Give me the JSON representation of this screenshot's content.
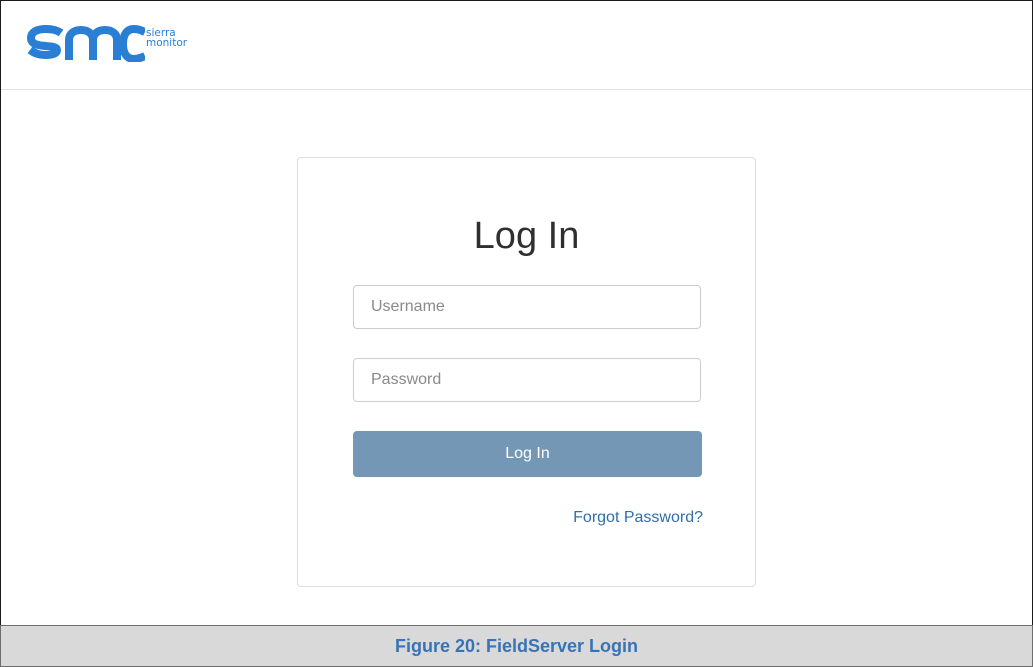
{
  "brand": {
    "logo_text": "smc",
    "sub_line1": "sierra",
    "sub_line2": "monitor",
    "color": "#2a7fd4"
  },
  "login": {
    "title": "Log In",
    "username_placeholder": "Username",
    "password_placeholder": "Password",
    "submit_label": "Log In",
    "forgot_label": "Forgot Password?"
  },
  "caption": {
    "text": "Figure 20: FieldServer Login"
  },
  "colors": {
    "button": "#7397b5",
    "link": "#2f6fae",
    "caption_text": "#3873b5",
    "caption_bg": "#d9d9d9"
  }
}
